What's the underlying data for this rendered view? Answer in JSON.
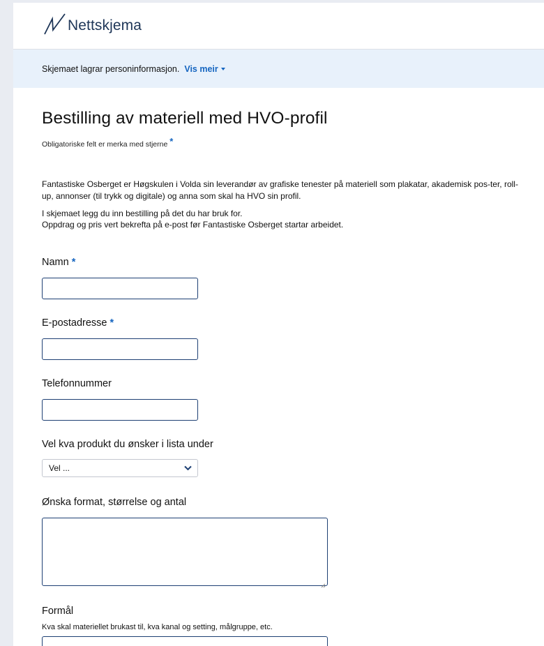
{
  "header": {
    "logo_text": "Nettskjema"
  },
  "notice": {
    "text": "Skjemaet lagrar personinformasjon.",
    "link_label": "Vis meir"
  },
  "form": {
    "title": "Bestilling av materiell med HVO-profil",
    "required_note": "Obligatoriske felt er merka med stjerne",
    "required_marker": "*",
    "intro": [
      "Fantastiske Osberget er Høgskulen i Volda sin leverandør av grafiske tenester på materiell som plakatar, akademisk pos-ter, roll-up, annonser (til trykk og digitale) og anna som skal ha HVO sin profil.",
      "I skjemaet legg du inn bestilling på det du har bruk for.",
      "Oppdrag og pris vert bekrefta på e-post før Fantastiske Osberget startar arbeidet."
    ],
    "fields": {
      "name": {
        "label": "Namn",
        "required_marker": "*",
        "value": ""
      },
      "email": {
        "label": "E-postadresse",
        "required_marker": "*",
        "value": ""
      },
      "phone": {
        "label": "Telefonnummer",
        "value": ""
      },
      "product": {
        "label": "Vel kva produkt du ønsker i lista under",
        "selected": "Vel ..."
      },
      "format": {
        "label": "Ønska format, størrelse og antal",
        "value": ""
      },
      "purpose": {
        "label": "Formål",
        "help": "Kva skal materiellet brukast til, kva kanal og setting, målgruppe, etc."
      }
    }
  },
  "colors": {
    "accent": "#1565c0",
    "notice_bg": "#e8f1fb",
    "input_border": "#1d3f73",
    "page_bg": "#e9ecf2"
  }
}
